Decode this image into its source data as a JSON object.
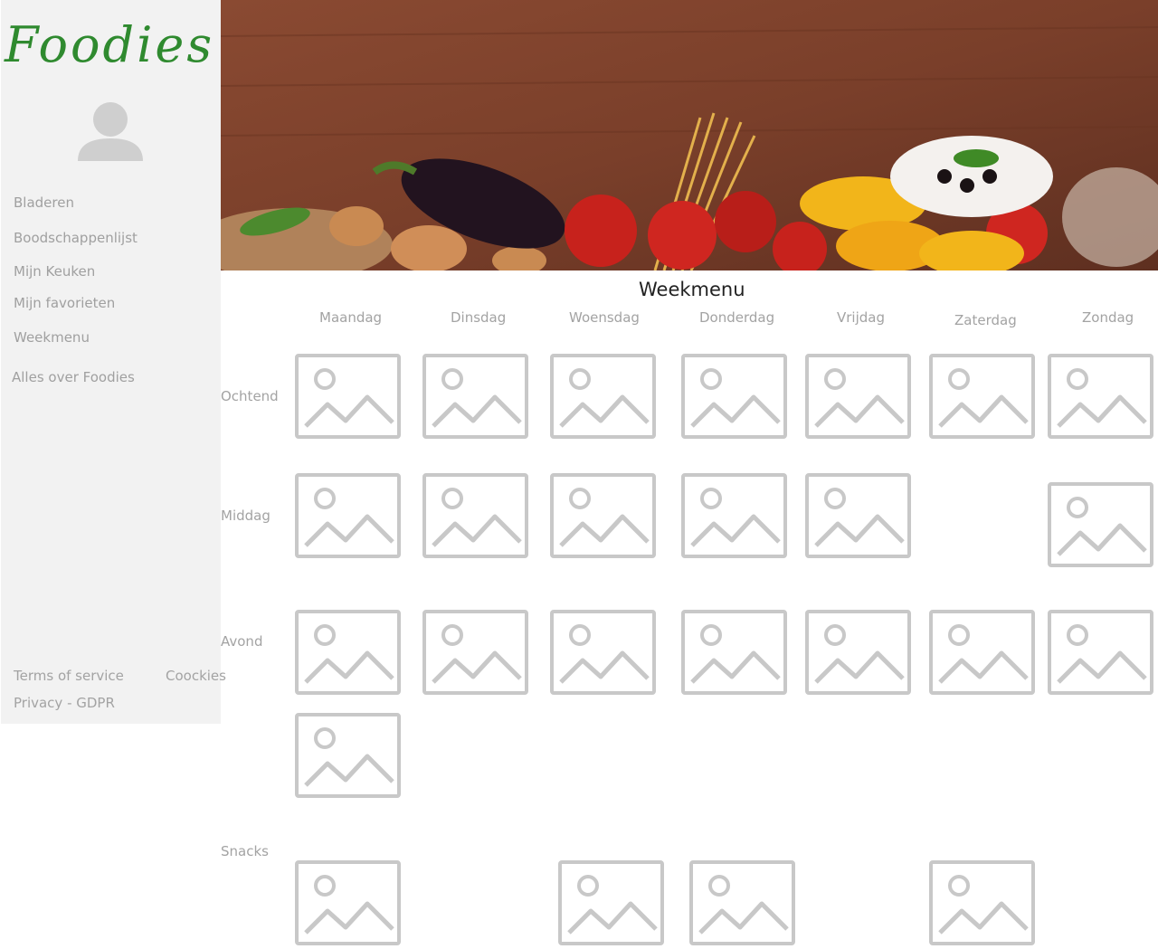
{
  "brand": {
    "logo_text": "Foodies",
    "logo_color": "#2f8a2f"
  },
  "sidebar": {
    "avatar_icon": "user-avatar-icon",
    "items": [
      {
        "label": "Bladeren"
      },
      {
        "label": "Boodschappenlijst"
      },
      {
        "label": "Mijn Keuken"
      },
      {
        "label": "Mijn favorieten"
      },
      {
        "label": "Weekmenu"
      },
      {
        "label": "Alles over Foodies"
      }
    ],
    "footer": {
      "terms": "Terms of service",
      "cookies": "Coockies",
      "privacy": "Privacy - GDPR"
    }
  },
  "hero": {
    "image_icon": "food-banner-photo"
  },
  "weekmenu": {
    "title": "Weekmenu",
    "days": [
      "Maandag",
      "Dinsdag",
      "Woensdag",
      "Donderdag",
      "Vrijdag",
      "Zaterdag",
      "Zondag"
    ],
    "meals": [
      "Ochtend",
      "Middag",
      "Avond",
      "Snacks"
    ],
    "image_icon": "image-placeholder-icon"
  }
}
